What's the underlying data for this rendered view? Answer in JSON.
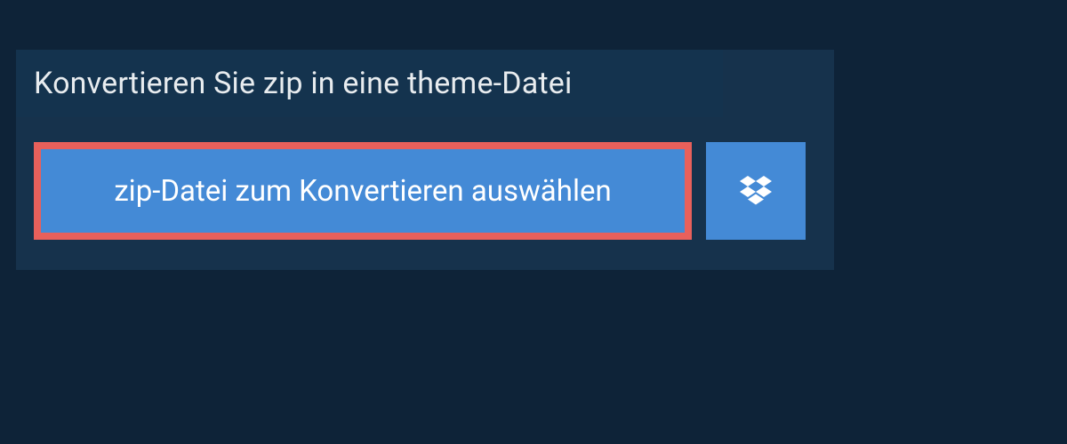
{
  "panel": {
    "title": "Konvertieren Sie zip in eine theme-Datei",
    "select_button_label": "zip-Datei zum Konvertieren auswählen"
  },
  "colors": {
    "page_bg": "#0e2338",
    "panel_bg": "#16324c",
    "titlebar_bg": "#14334e",
    "button_bg": "#448ad6",
    "highlight_border": "#e8605b",
    "text_light": "#e8ecef",
    "text_white": "#ffffff"
  }
}
